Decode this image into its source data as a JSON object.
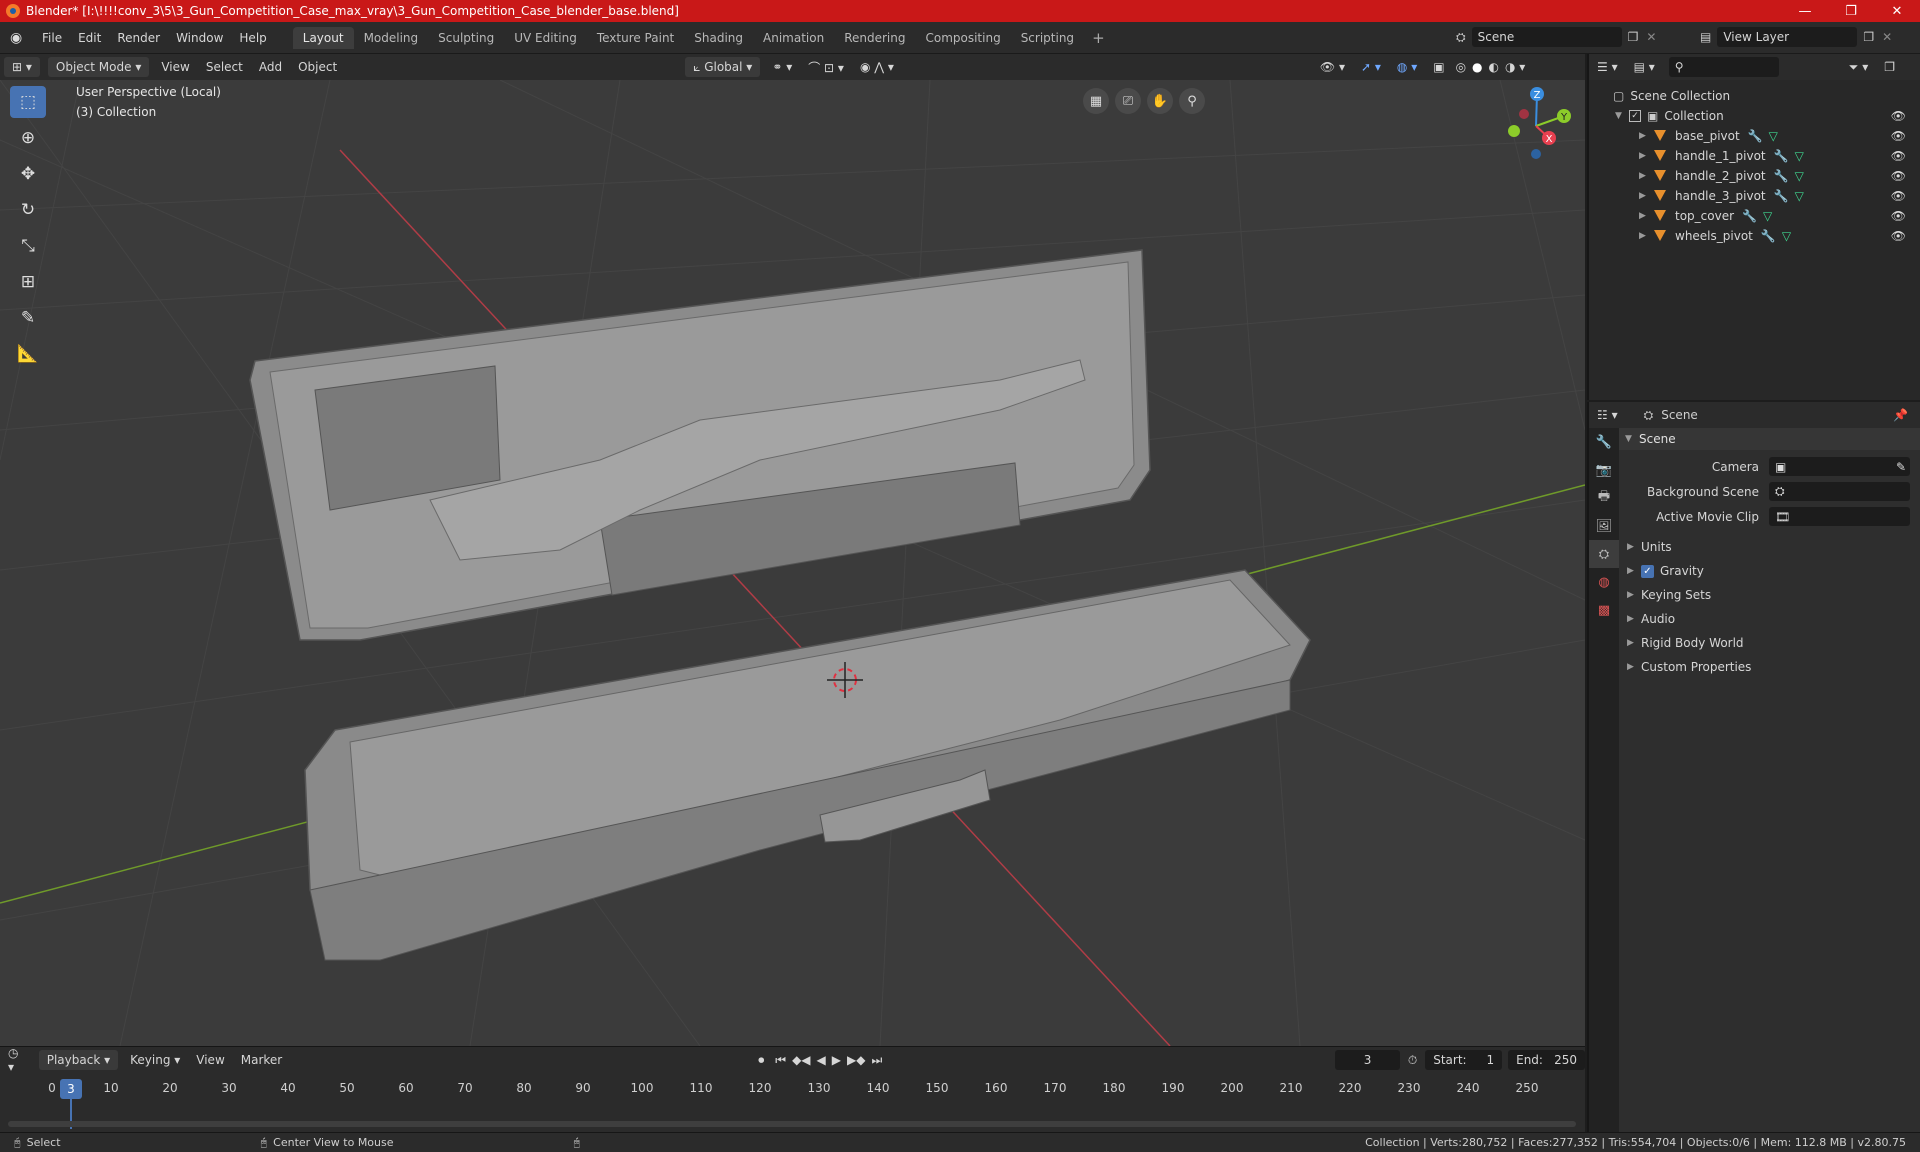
{
  "window": {
    "title": "Blender* [I:\\!!!!conv_3\\5\\3_Gun_Competition_Case_max_vray\\3_Gun_Competition_Case_blender_base.blend]",
    "minimize": "—",
    "maximize": "❐",
    "close": "✕"
  },
  "menu": {
    "file": "File",
    "edit": "Edit",
    "render": "Render",
    "window": "Window",
    "help": "Help"
  },
  "workspaces": [
    "Layout",
    "Modeling",
    "Sculpting",
    "UV Editing",
    "Texture Paint",
    "Shading",
    "Animation",
    "Rendering",
    "Compositing",
    "Scripting"
  ],
  "scene": {
    "name": "Scene",
    "view_layer": "View Layer"
  },
  "viewport_header": {
    "mode": "Object Mode",
    "view": "View",
    "select": "Select",
    "add": "Add",
    "object": "Object",
    "transform": "Global"
  },
  "viewport_info": {
    "perspective": "User Perspective (Local)",
    "collection": "(3) Collection"
  },
  "gizmo": {
    "x": "X",
    "y": "Y",
    "z": "Z"
  },
  "outliner": {
    "search_placeholder": "",
    "root": "Scene Collection",
    "collection": "Collection",
    "objects": [
      "base_pivot",
      "handle_1_pivot",
      "handle_2_pivot",
      "handle_3_pivot",
      "top_cover",
      "wheels_pivot"
    ]
  },
  "properties": {
    "context": "Scene",
    "panel": "Scene",
    "camera_label": "Camera",
    "background_label": "Background Scene",
    "movie_clip_label": "Active Movie Clip",
    "sections": {
      "units": "Units",
      "gravity": "Gravity",
      "keying": "Keying Sets",
      "audio": "Audio",
      "rigid": "Rigid Body World",
      "custom": "Custom Properties"
    }
  },
  "timeline": {
    "playback": "Playback",
    "keying": "Keying",
    "view": "View",
    "marker": "Marker",
    "current_frame": "3",
    "start_label": "Start:",
    "start": "1",
    "end_label": "End:",
    "end": "250",
    "ticks": [
      "0",
      "10",
      "20",
      "30",
      "40",
      "50",
      "60",
      "70",
      "80",
      "90",
      "100",
      "110",
      "120",
      "130",
      "140",
      "150",
      "160",
      "170",
      "180",
      "190",
      "200",
      "210",
      "220",
      "230",
      "240",
      "250"
    ]
  },
  "status": {
    "select": "Select",
    "center": "Center View to Mouse",
    "stats": "Collection | Verts:280,752 | Faces:277,352 | Tris:554,704 | Objects:0/6 | Mem: 112.8 MB | v2.80.75"
  },
  "colors": {
    "accent": "#4773b3",
    "titlebar": "#c91818",
    "object_icon": "#e8902d",
    "x_axis": "#e84050",
    "y_axis": "#8ccc2a",
    "z_axis": "#3a8ee0"
  }
}
